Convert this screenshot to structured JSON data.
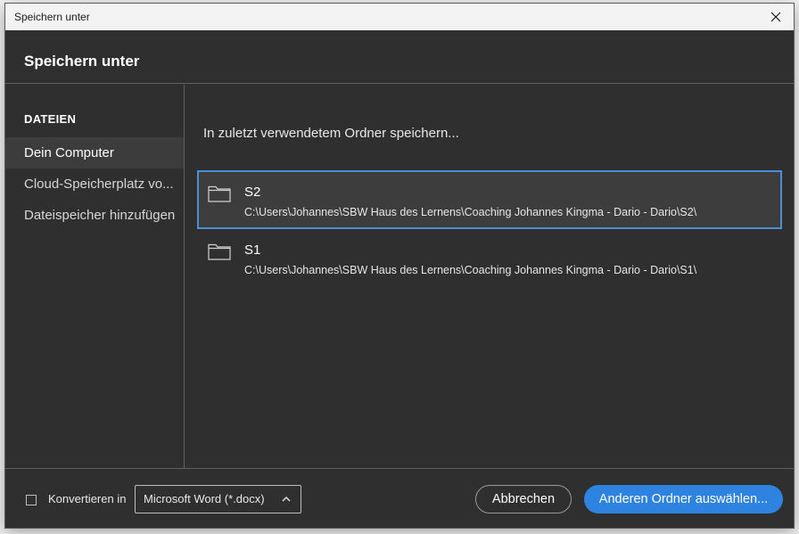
{
  "window": {
    "title": "Speichern unter"
  },
  "dialog": {
    "heading": "Speichern unter"
  },
  "sidebar": {
    "section_label": "DATEIEN",
    "items": [
      {
        "label": "Dein Computer",
        "active": true
      },
      {
        "label": "Cloud-Speicherplatz vo..."
      },
      {
        "label": "Dateispeicher hinzufügen"
      }
    ]
  },
  "main": {
    "subheading": "In zuletzt verwendetem Ordner speichern...",
    "folders": [
      {
        "name": "S2",
        "path": "C:\\Users\\Johannes\\SBW Haus des Lernens\\Coaching Johannes Kingma - Dario - Dario\\S2\\",
        "selected": true
      },
      {
        "name": "S1",
        "path": "C:\\Users\\Johannes\\SBW Haus des Lernens\\Coaching Johannes Kingma - Dario - Dario\\S1\\"
      }
    ]
  },
  "footer": {
    "convert_label": "Konvertieren in",
    "format_selected": "Microsoft Word (*.docx)",
    "cancel_label": "Abbrechen",
    "choose_folder_label": "Anderen Ordner auswählen..."
  },
  "colors": {
    "accent": "#2f83e0",
    "selection_border": "#4a90d9",
    "dialog_bg": "#2f2f2f"
  },
  "icons": {
    "close": "close-icon",
    "folder": "folder-icon",
    "chevron": "chevron-up-icon"
  }
}
